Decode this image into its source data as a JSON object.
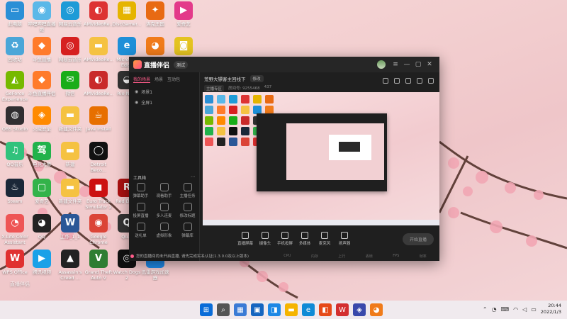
{
  "desktop": {
    "icons": [
      {
        "label": "此电脑",
        "icon": "computer-icon",
        "color": "#2b8fd6",
        "glyph": "▭"
      },
      {
        "label": "哔哩哔哩直播姬",
        "icon": "bilibili-live-icon",
        "color": "#5bb8e8",
        "glyph": "◉"
      },
      {
        "label": "网易云音乐",
        "icon": "netease-music-icon",
        "color": "#1e9bd7",
        "glyph": "◎"
      },
      {
        "label": "AMVideoRe...",
        "icon": "amvideo-icon",
        "color": "#d33",
        "glyph": "◐"
      },
      {
        "label": "DiscGamer...",
        "icon": "discgamer-icon",
        "color": "#e5b400",
        "glyph": "▦"
      },
      {
        "label": "洛克王国",
        "icon": "roco-icon",
        "color": "#e86a13",
        "glyph": "✦"
      },
      {
        "label": "爱奇艺",
        "icon": "iqiyi-icon",
        "color": "#e33a8a",
        "glyph": "▶"
      },
      {
        "label": "回收站",
        "icon": "recycle-bin-icon",
        "color": "#4aa6d8",
        "glyph": "♻"
      },
      {
        "label": "斗鱼直播",
        "icon": "douyu-icon",
        "color": "#ff7b2b",
        "glyph": "◆"
      },
      {
        "label": "网易云音乐",
        "icon": "netease-music-icon",
        "color": "#d62020",
        "glyph": "◎"
      },
      {
        "label": "AMVideoRe...",
        "icon": "folder-icon",
        "color": "#f5c242",
        "glyph": "▬"
      },
      {
        "label": "Microsoft Edge",
        "icon": "edge-icon",
        "color": "#1e8fd8",
        "glyph": "e"
      },
      {
        "label": "直播伴侣",
        "icon": "bilibili-icon",
        "color": "#f07b1a",
        "glyph": "◕"
      },
      {
        "label": "WeGame",
        "icon": "wegame-icon",
        "color": "#e4c320",
        "glyph": "◙"
      },
      {
        "label": "GeForce Experience",
        "icon": "nvidia-icon",
        "color": "#76b900",
        "glyph": "◭"
      },
      {
        "label": "斗鱼直播伴侣",
        "icon": "douyu-companion-icon",
        "color": "#ff7b2b",
        "glyph": "◆"
      },
      {
        "label": "微信",
        "icon": "wechat-icon",
        "color": "#1aad19",
        "glyph": "✉"
      },
      {
        "label": "AMVideoRe...",
        "icon": "amvideo-icon",
        "color": "#c92a2a",
        "glyph": "◐"
      },
      {
        "label": "Rio Ne...",
        "icon": "rio-icon",
        "color": "#333",
        "glyph": "◒"
      },
      {
        "label": "OBS Studio",
        "icon": "obs-icon",
        "color": "#302e31",
        "glyph": "◍"
      },
      {
        "label": "火绒安全",
        "icon": "huorong-icon",
        "color": "#ff8a00",
        "glyph": "◈"
      },
      {
        "label": "新建文件夹",
        "icon": "folder-icon",
        "color": "#f5c242",
        "glyph": "▬"
      },
      {
        "label": "Java Install",
        "icon": "java-icon",
        "color": "#e76f00",
        "glyph": "☕"
      },
      {
        "label": "QQ音乐",
        "icon": "qq-music-icon",
        "color": "#31c27c",
        "glyph": "♫"
      },
      {
        "label": "电竞大师",
        "icon": "gaming-icon",
        "color": "#21b24b",
        "glyph": "驾"
      },
      {
        "label": "新建",
        "icon": "folder-icon",
        "color": "#f5c242",
        "glyph": "▬"
      },
      {
        "label": "Detroit Beco...",
        "icon": "detroit-icon",
        "color": "#111",
        "glyph": "◯"
      },
      {
        "label": "Steam",
        "icon": "steam-icon",
        "color": "#1b2838",
        "glyph": "♨"
      },
      {
        "label": "爱奇艺",
        "icon": "iqiyi-icon",
        "color": "#33b34a",
        "glyph": "▢"
      },
      {
        "label": "新建文件夹",
        "icon": "folder-icon",
        "color": "#f5c242",
        "glyph": "▬"
      },
      {
        "label": "Euro Truck Simulator 2",
        "icon": "truck-icon",
        "color": "#c11",
        "glyph": "◼"
      },
      {
        "label": "Red Dead",
        "icon": "rdr-icon",
        "color": "#a11",
        "glyph": "R"
      },
      {
        "label": "X-Lite Color Assistant",
        "icon": "xlite-icon",
        "color": "#e55",
        "glyph": "◔"
      },
      {
        "label": "QQ",
        "icon": "qq-icon",
        "color": "#222",
        "glyph": "◕"
      },
      {
        "label": "工作_1_1",
        "icon": "word-icon",
        "color": "#2b5797",
        "glyph": "W"
      },
      {
        "label": "Google Chrome",
        "icon": "chrome-icon",
        "color": "#db4437",
        "glyph": "◉"
      },
      {
        "label": "Qu...",
        "icon": "quark-icon",
        "color": "#333",
        "glyph": "Q"
      },
      {
        "label": "WPS Office",
        "icon": "wps-icon",
        "color": "#e03030",
        "glyph": "W"
      },
      {
        "label": "腾讯视频",
        "icon": "tencent-video-icon",
        "color": "#1aa1e8",
        "glyph": "▶"
      },
      {
        "label": "Assassin's Creed ...",
        "icon": "ac-icon",
        "color": "#222",
        "glyph": "▲"
      },
      {
        "label": "Grand Theft Auto V",
        "icon": "gta-icon",
        "color": "#2e7d32",
        "glyph": "V"
      },
      {
        "label": "Watch Dogs 2",
        "icon": "watchdogs-icon",
        "color": "#111",
        "glyph": "◎"
      },
      {
        "label": "迅雷游戏加速器",
        "icon": "accelerator-icon",
        "color": "#1e88e5",
        "glyph": "⚡"
      }
    ]
  },
  "app": {
    "logo": "直播伴侣",
    "badge": "测试",
    "side_tabs": [
      "我的场景",
      "场景",
      "互动包"
    ],
    "scene_rows": [
      "场景1",
      "全屏1"
    ],
    "tools_title": "工具箱",
    "tools": [
      {
        "label": "弹幕助手"
      },
      {
        "label": "观看助手"
      },
      {
        "label": "主播任务"
      },
      {
        "label": "投屏直播"
      },
      {
        "label": "多人连麦"
      },
      {
        "label": "修改标题"
      },
      {
        "label": "送礼单"
      },
      {
        "label": "虚拟形象"
      },
      {
        "label": "弹幕库"
      }
    ],
    "room_title": "荒野大镖客主回线下",
    "room_edit": "修改",
    "room_tag": "主播专区",
    "room_id": "房间号: 9255468",
    "room_fans": "437",
    "controls": [
      {
        "label": "直播屏幕"
      },
      {
        "label": "摄像头"
      },
      {
        "label": "手机投屏"
      },
      {
        "label": "多媒体"
      },
      {
        "label": "麦克风"
      },
      {
        "label": "扬声器"
      }
    ],
    "go_live": "开始直播",
    "notice": "您的直播间尚未开启直播, 请先完成实名认证(1.3.0.0及以上版本)",
    "status_items": [
      "CPU",
      "内存",
      "上行",
      "丢帧",
      "FPS",
      "帧率"
    ]
  },
  "taskbar": {
    "apps": [
      {
        "icon": "windows-start-icon",
        "glyph": "⊞",
        "color": "#0a6cd8"
      },
      {
        "icon": "search-icon",
        "glyph": "⌕",
        "color": "#555"
      },
      {
        "icon": "widgets-icon",
        "glyph": "▦",
        "color": "#3a7bd5"
      },
      {
        "icon": "task-view-icon",
        "glyph": "▣",
        "color": "#1565c0"
      },
      {
        "icon": "store-icon",
        "glyph": "◨",
        "color": "#1e88e5"
      },
      {
        "icon": "explorer-icon",
        "glyph": "▬",
        "color": "#f5b400"
      },
      {
        "icon": "edge-icon",
        "glyph": "e",
        "color": "#0f8bd6"
      },
      {
        "icon": "office-icon",
        "glyph": "◧",
        "color": "#e64a19"
      },
      {
        "icon": "wps-icon",
        "glyph": "W",
        "color": "#d32f2f"
      },
      {
        "icon": "app-icon",
        "glyph": "◈",
        "color": "#3949ab"
      },
      {
        "icon": "live-companion-icon",
        "glyph": "◕",
        "color": "#f07b1a"
      }
    ],
    "time": "20:44",
    "date": "2022/1/3"
  },
  "watermark": "直播伴侣"
}
